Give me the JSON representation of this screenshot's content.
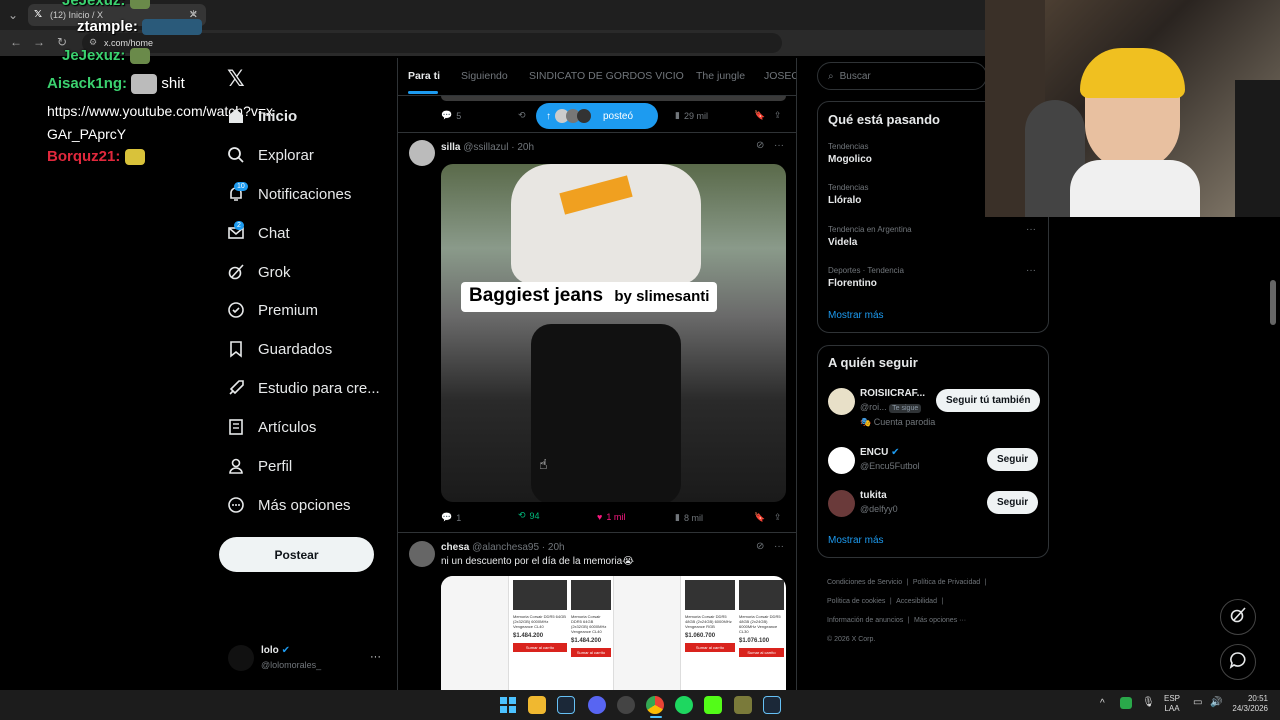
{
  "browser": {
    "tab_title": "(12) Inicio / X",
    "url": "x.com/home"
  },
  "chat": [
    {
      "user": "JeJexuz:",
      "color": "#3bd16f",
      "text": ""
    },
    {
      "user": "ztample:",
      "color": "#ffffff",
      "text": ""
    },
    {
      "user": "JeJexuz:",
      "color": "#3bd16f",
      "text": ""
    },
    {
      "user": "Aisack1ng:",
      "color": "#3bd16f",
      "text": "shit"
    },
    {
      "user": "",
      "color": "#ffffff",
      "text": "https://www.youtube.com/watch?v=xGAr_PAprcY"
    },
    {
      "user": "Borquz21:",
      "color": "#e0283c",
      "text": ""
    }
  ],
  "nav": {
    "items": [
      {
        "label": "Inicio",
        "icon": "home-icon"
      },
      {
        "label": "Explorar",
        "icon": "search-icon"
      },
      {
        "label": "Notificaciones",
        "icon": "bell-icon",
        "badge": "10"
      },
      {
        "label": "Chat",
        "icon": "mail-icon",
        "badge": "2"
      },
      {
        "label": "Grok",
        "icon": "grok-icon"
      },
      {
        "label": "Premium",
        "icon": "premium-icon"
      },
      {
        "label": "Guardados",
        "icon": "bookmark-icon"
      },
      {
        "label": "Estudio para cre...",
        "icon": "rocket-icon"
      },
      {
        "label": "Artículos",
        "icon": "article-icon"
      },
      {
        "label": "Perfil",
        "icon": "person-icon"
      },
      {
        "label": "Más opciones",
        "icon": "more-circle-icon"
      }
    ],
    "post_label": "Postear",
    "account": {
      "name": "lolo",
      "handle": "@lolomorales_"
    }
  },
  "feed": {
    "tabs": [
      "Para ti",
      "Siguiendo",
      "SINDICATO DE GORDOS VICIO",
      "The jungle",
      "JOSEO"
    ],
    "pill_label": "posteó",
    "top_post_stats": {
      "replies": "5",
      "views": "29 mil"
    },
    "posts": [
      {
        "name": "silla",
        "handle": "@ssillazul",
        "time": "20h",
        "text": "",
        "image_caption": "Baggiest jeans",
        "image_credit": "by slimesanti",
        "replies": "1",
        "reposts": "94",
        "likes": "1 mil",
        "views": "8 mil"
      },
      {
        "name": "chesa",
        "handle": "@alanchesa95",
        "time": "20h",
        "text": "ni un descuento por el día de la memoria😭",
        "products": [
          {
            "name": "Memoria Corsair DDR5 64GB (2x32GB) 6000MHz Vengeance CL40",
            "price": "$1.484.200"
          },
          {
            "name": "Memoria Corsair DDR5 64GB (2x32GB) 6000MHz Vengeance CL40",
            "price": "$1.484.200"
          },
          {
            "name": "Memoria Corsair DDR5 48GB (2x24GB) 6000MHz Vengeance RGB",
            "price": "$1.060.700"
          },
          {
            "name": "Memoria Corsair DDR5 48GB (2x24GB) 6000MHz Vengeance CL30",
            "price": "$1.076.100"
          }
        ],
        "add_to_cart": "Sumar al carrito"
      }
    ]
  },
  "sidebar": {
    "search_placeholder": "Buscar",
    "trends_title": "Qué está pasando",
    "trends": [
      {
        "context": "Tendencias",
        "name": "Mogolico"
      },
      {
        "context": "Tendencias",
        "name": "Llóralo"
      },
      {
        "context": "Tendencia en Argentina",
        "name": "Videla"
      },
      {
        "context": "Deportes · Tendencia",
        "name": "Florentino"
      }
    ],
    "show_more": "Mostrar más",
    "follow_title": "A quién seguir",
    "follow": [
      {
        "name": "ROISIICRAF...",
        "handle": "@roi...",
        "badge": "Te sigue",
        "note": "Cuenta parodia",
        "button": "Seguir tú también"
      },
      {
        "name": "ENCU",
        "handle": "@Encu5Futbol",
        "button": "Seguir"
      },
      {
        "name": "tukita",
        "handle": "@delfyy0",
        "button": "Seguir"
      }
    ],
    "footer": [
      "Condiciones de Servicio",
      "Política de Privacidad",
      "Política de cookies",
      "Accesibilidad",
      "Información de anuncios",
      "Más opciones ···",
      "© 2026 X Corp."
    ]
  },
  "taskbar": {
    "lang": "ESP",
    "lang2": "LAA",
    "time": "20:51",
    "date": "24/3/2026"
  },
  "colors": {
    "accent": "#1d9bf0",
    "repost": "#00ba7c",
    "like": "#f91880"
  }
}
